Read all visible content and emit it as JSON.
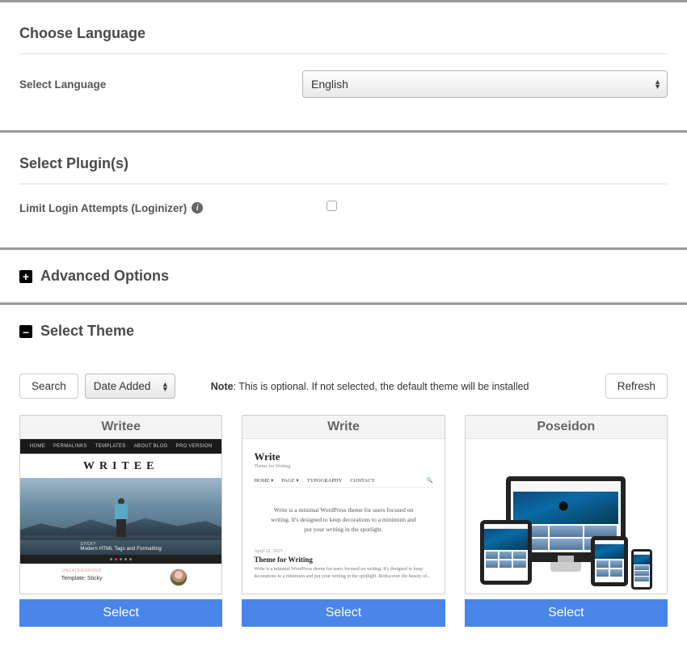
{
  "language": {
    "section_title": "Choose Language",
    "label": "Select Language",
    "value": "English"
  },
  "plugins": {
    "section_title": "Select Plugin(s)",
    "loginizer_label": "Limit Login Attempts (Loginizer)",
    "loginizer_checked": false
  },
  "advanced": {
    "title": "Advanced Options",
    "expanded": false
  },
  "theme_section": {
    "title": "Select Theme",
    "expanded": true,
    "search_button": "Search",
    "sort_value": "Date Added",
    "note_prefix": "Note",
    "note_text": ": This is optional. If not selected, the default theme will be installed",
    "refresh_button": "Refresh",
    "select_button": "Select",
    "themes": [
      {
        "name": "Writee"
      },
      {
        "name": "Write"
      },
      {
        "name": "Poseidon"
      }
    ],
    "preview": {
      "writee": {
        "nav": [
          "HOME",
          "PERMALINKS",
          "TEMPLATES",
          "ABOUT BLOG",
          "PRO VERSION"
        ],
        "logo": "WRITEE",
        "caption_small": "STICKY",
        "caption": "Modern HTML Tags and Formatting",
        "cat": "UNCATEGORIZED",
        "title": "Template: Sticky"
      },
      "write": {
        "heading": "Write",
        "sub": "Theme for Writing",
        "nav": [
          "HOME ▾",
          "PAGE ▾",
          "TYPOGRAPHY",
          "CONTACT"
        ],
        "body": "Write is a minimal WordPress theme for users focused on writing. It's designed to keep decorations to a minimum and put your writing in the spotlight.",
        "date": "April 22, 2015",
        "h2": "Theme for Writing",
        "p2": "Write is a minimal WordPress theme for users focused on writing. It's designed to keep decorations to a minimum and put your writing in the spotlight. Rediscover the beauty of..."
      }
    }
  }
}
